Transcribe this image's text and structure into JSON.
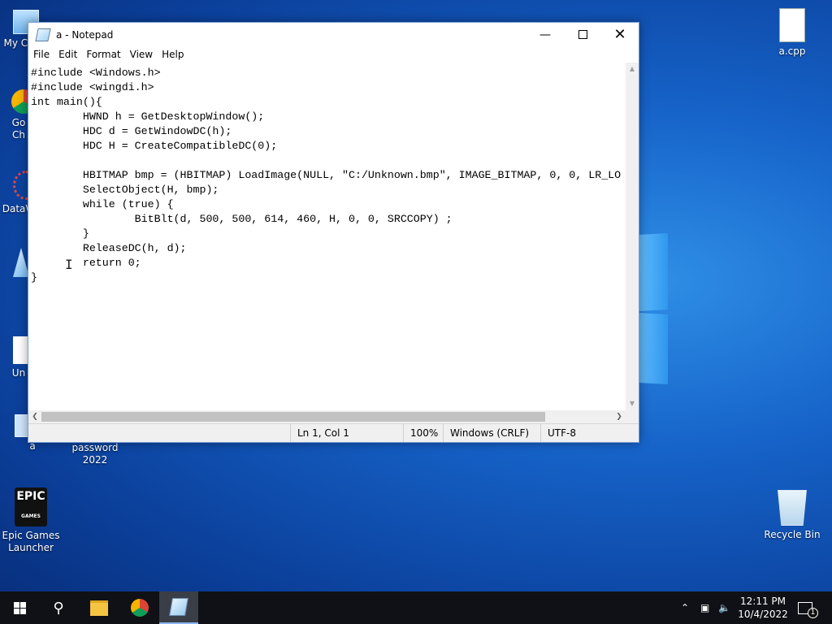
{
  "desktop": {
    "icons": [
      {
        "label": "My Co",
        "id": "my-computer"
      },
      {
        "label": "Go\nCh",
        "id": "google-chrome"
      },
      {
        "label": "DataW",
        "id": "dataw"
      },
      {
        "label": "Un",
        "id": "un"
      },
      {
        "label": "a",
        "id": "a"
      },
      {
        "label": "password\n2022",
        "id": "password-2022"
      },
      {
        "label": "Epic Games\nLauncher",
        "id": "epic-games-launcher"
      },
      {
        "label": "a.cpp",
        "id": "a-cpp"
      },
      {
        "label": "Recycle Bin",
        "id": "recycle-bin"
      }
    ]
  },
  "notepad": {
    "title": "a - Notepad",
    "menu": [
      "File",
      "Edit",
      "Format",
      "View",
      "Help"
    ],
    "content": "#include <Windows.h>\n#include <wingdi.h>\nint main(){\n        HWND h = GetDesktopWindow();\n        HDC d = GetWindowDC(h);\n        HDC H = CreateCompatibleDC(0);\n\n        HBITMAP bmp = (HBITMAP) LoadImage(NULL, \"C:/Unknown.bmp\", IMAGE_BITMAP, 0, 0, LR_LO\n        SelectObject(H, bmp);\n        while (true) {\n                BitBlt(d, 500, 500, 614, 460, H, 0, 0, SRCCOPY) ;\n        }\n        ReleaseDC(h, d);\n        return 0;\n}",
    "status": {
      "position": "Ln 1, Col 1",
      "zoom": "100%",
      "line_ending": "Windows (CRLF)",
      "encoding": "UTF-8"
    }
  },
  "taskbar": {
    "apps": [
      "start-icon",
      "search-icon",
      "file-explorer-icon",
      "chrome-icon",
      "notepad-icon"
    ],
    "time": "12:11 PM",
    "date": "10/4/2022",
    "notification_count": "1"
  }
}
